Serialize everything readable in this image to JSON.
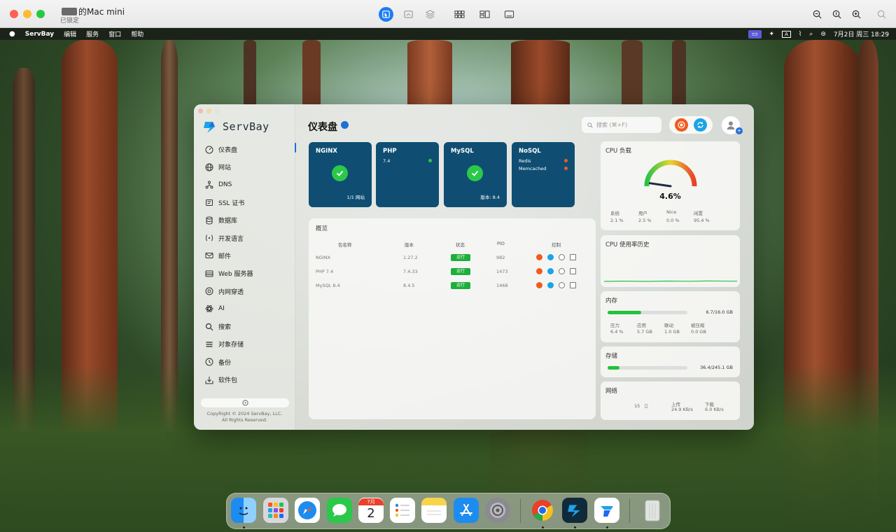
{
  "viewer": {
    "title": "的Mac mini",
    "subtitle": "已锁定"
  },
  "menubar": {
    "app_name": "ServBay",
    "items": [
      "编辑",
      "服务",
      "窗口",
      "帮助"
    ],
    "clock": "7月2日 周三  18:29"
  },
  "app": {
    "brand": "ServBay",
    "page_title": "仪表盘",
    "search_placeholder": "搜索 (⌘+F)",
    "nav": [
      {
        "label": "仪表盘",
        "icon": "dashboard-icon"
      },
      {
        "label": "网站",
        "icon": "globe-icon"
      },
      {
        "label": "DNS",
        "icon": "dns-icon"
      },
      {
        "label": "SSL 证书",
        "icon": "certificate-icon"
      },
      {
        "label": "数据库",
        "icon": "database-icon"
      },
      {
        "label": "开发语言",
        "icon": "code-icon"
      },
      {
        "label": "邮件",
        "icon": "mail-icon"
      },
      {
        "label": "Web 服务器",
        "icon": "server-icon"
      },
      {
        "label": "内网穿透",
        "icon": "tunnel-icon"
      },
      {
        "label": "AI",
        "icon": "ai-icon"
      },
      {
        "label": "搜索",
        "icon": "search-icon"
      },
      {
        "label": "对象存储",
        "icon": "storage-icon"
      },
      {
        "label": "备份",
        "icon": "backup-icon"
      },
      {
        "label": "软件包",
        "icon": "package-icon"
      }
    ],
    "copyright_line1": "CopyRight © 2024 ServBay, LLC.",
    "copyright_line2": "All Rights Reserved."
  },
  "services": {
    "nginx": {
      "name": "NGINX",
      "foot": "1/1 网站"
    },
    "php": {
      "name": "PHP",
      "version": "7.4"
    },
    "mysql": {
      "name": "MySQL",
      "foot": "版本: 8.4"
    },
    "nosql": {
      "name": "NoSQL",
      "rows": [
        "Redis",
        "Memcached"
      ]
    }
  },
  "overview": {
    "title": "概览",
    "headers": {
      "name": "包名称",
      "version": "版本",
      "status": "状态",
      "pid": "PID",
      "control": "控制"
    },
    "rows": [
      {
        "name": "NGINX",
        "version": "1.27.2",
        "status": "运行",
        "pid": "982"
      },
      {
        "name": "PHP 7.4",
        "version": "7.4.33",
        "status": "运行",
        "pid": "1473"
      },
      {
        "name": "MySQL 8.4",
        "version": "8.4.5",
        "status": "运行",
        "pid": "1468"
      }
    ]
  },
  "cpu": {
    "title": "CPU 负载",
    "load": "4.6%",
    "load_value": 4.6,
    "stats": [
      {
        "label": "系统",
        "value": "2.1 %"
      },
      {
        "label": "用户",
        "value": "2.5 %"
      },
      {
        "label": "Nice",
        "value": "0.0 %"
      },
      {
        "label": "闲置",
        "value": "95.4 %"
      }
    ]
  },
  "cpu_history": {
    "title": "CPU 使用率历史"
  },
  "memory": {
    "title": "内存",
    "usage": "6.7/16.0 GB",
    "fraction": 0.42,
    "stats": [
      {
        "label": "压力",
        "value": "6.4 %"
      },
      {
        "label": "应用",
        "value": "5.7 GB"
      },
      {
        "label": "联动",
        "value": "1.0 GB"
      },
      {
        "label": "被压缩",
        "value": "0.0 GB"
      }
    ]
  },
  "storage": {
    "title": "存储",
    "usage": "36.4/245.1 GB",
    "fraction": 0.15
  },
  "network": {
    "title": "网络",
    "count": "15",
    "upload_label": "上传",
    "upload_value": "24.9 KB/s",
    "download_label": "下载",
    "download_value": "6.0 KB/s"
  },
  "colors": {
    "accent": "#1f6fd6",
    "service_card": "#0f4e72",
    "running": "#1eae3c",
    "stop": "#f25a1d",
    "sync": "#1ca3e8"
  },
  "dock": [
    "finder-icon",
    "launchpad-icon",
    "safari-icon",
    "messages-icon",
    "calendar-icon",
    "reminders-icon",
    "notes-icon",
    "app-store-icon",
    "system-settings-icon",
    "chrome-icon",
    "servbay-icon",
    "todesk-icon",
    "trash-icon"
  ],
  "dock_calendar": {
    "month": "7月",
    "day": "2"
  }
}
